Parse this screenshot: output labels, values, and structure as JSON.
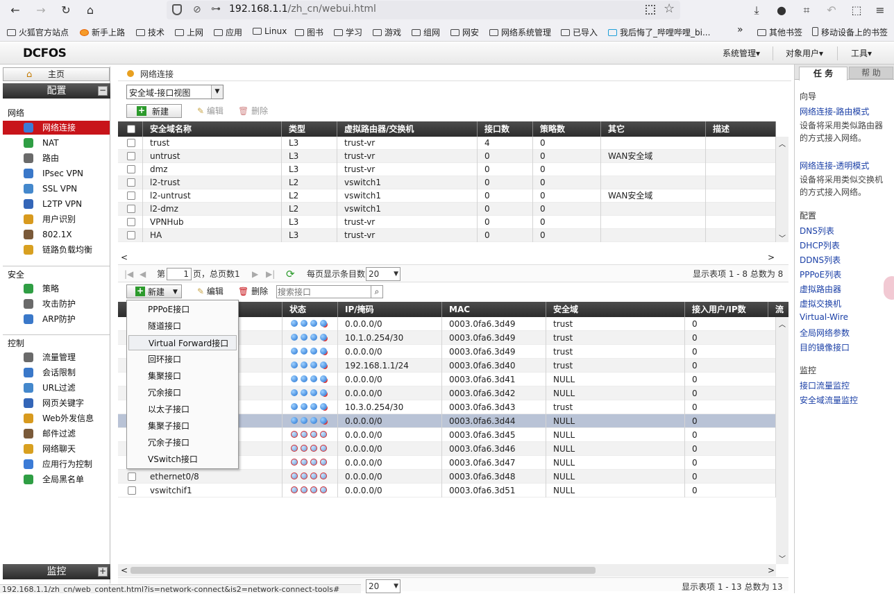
{
  "browser": {
    "url_host": "192.168.1.1",
    "url_path": "/zh_cn/webui.html",
    "bookmarks": [
      "火狐官方站点",
      "新手上路",
      "技术",
      "上网",
      "应用",
      "Linux",
      "图书",
      "学习",
      "游戏",
      "组网",
      "网安",
      "网络系统管理",
      "已导入",
      "我后悔了_哔哩哔哩_bi...",
      "其他书签",
      "移动设备上的书签"
    ],
    "status_url": "192.168.1.1/zh_cn/web_content.html?is=network-connect&is2=network-connect-tools#"
  },
  "app": {
    "logo": "DCFOS",
    "menus": [
      "系统管理▾",
      "对象用户▾",
      "工具▾"
    ]
  },
  "left": {
    "home": "主页",
    "config_bar": "配置",
    "config_toggle": "−",
    "sections": [
      {
        "title": "网络",
        "items": [
          "网络连接",
          "NAT",
          "路由",
          "IPsec VPN",
          "SSL VPN",
          "L2TP VPN",
          "用户识别",
          "802.1X",
          "链路负载均衡"
        ]
      },
      {
        "title": "安全",
        "items": [
          "策略",
          "攻击防护",
          "ARP防护"
        ]
      },
      {
        "title": "控制",
        "items": [
          "流量管理",
          "会话限制",
          "URL过滤",
          "网页关键字",
          "Web外发信息",
          "邮件过滤",
          "网络聊天",
          "应用行为控制",
          "全局黑名单"
        ]
      }
    ],
    "monitor_bar": "监控",
    "monitor_toggle": "+"
  },
  "main": {
    "breadcrumb": "网络连接",
    "view_select": "安全域-接口视图",
    "zone_toolbar": {
      "new": "新建",
      "edit": "编辑",
      "delete": "删除"
    },
    "zone_columns": [
      "安全域名称",
      "类型",
      "虚拟路由器/交换机",
      "接口数",
      "策略数",
      "其它",
      "描述"
    ],
    "zones": [
      [
        "trust",
        "L3",
        "trust-vr",
        "4",
        "0",
        ""
      ],
      [
        "untrust",
        "L3",
        "trust-vr",
        "0",
        "0",
        "WAN安全域"
      ],
      [
        "dmz",
        "L3",
        "trust-vr",
        "0",
        "0",
        ""
      ],
      [
        "l2-trust",
        "L2",
        "vswitch1",
        "0",
        "0",
        ""
      ],
      [
        "l2-untrust",
        "L2",
        "vswitch1",
        "0",
        "0",
        "WAN安全域"
      ],
      [
        "l2-dmz",
        "L2",
        "vswitch1",
        "0",
        "0",
        ""
      ],
      [
        "VPNHub",
        "L3",
        "trust-vr",
        "0",
        "0",
        ""
      ],
      [
        "HA",
        "L3",
        "trust-vr",
        "0",
        "0",
        ""
      ]
    ],
    "zone_pager": {
      "page_prefix": "第",
      "page": "1",
      "page_suffix": "页，总页数1",
      "per_page_label": "每页显示条目数",
      "per_page": "20",
      "summary": "显示表项 1 - 8 总数为 8"
    },
    "if_toolbar": {
      "new": "新建",
      "edit": "编辑",
      "delete": "删除",
      "search_placeholder": "搜索接口"
    },
    "if_columns": [
      "状态",
      "IP/掩码",
      "MAC",
      "安全域",
      "接入用户/IP数",
      "流"
    ],
    "interfaces": [
      {
        "name": "",
        "status": "up",
        "ip": "0.0.0.0/0",
        "mac": "0003.0fa6.3d49",
        "zone": "trust",
        "users": "0"
      },
      {
        "name": "",
        "status": "up",
        "ip": "10.1.0.254/30",
        "mac": "0003.0fa6.3d49",
        "zone": "trust",
        "users": "0"
      },
      {
        "name": "",
        "status": "up",
        "ip": "0.0.0.0/0",
        "mac": "0003.0fa6.3d49",
        "zone": "trust",
        "users": "0"
      },
      {
        "name": "",
        "status": "up",
        "ip": "192.168.1.1/24",
        "mac": "0003.0fa6.3d40",
        "zone": "trust",
        "users": "0"
      },
      {
        "name": "",
        "status": "up",
        "ip": "0.0.0.0/0",
        "mac": "0003.0fa6.3d41",
        "zone": "NULL",
        "users": "0"
      },
      {
        "name": "",
        "status": "up",
        "ip": "0.0.0.0/0",
        "mac": "0003.0fa6.3d42",
        "zone": "NULL",
        "users": "0"
      },
      {
        "name": "",
        "status": "up",
        "ip": "10.3.0.254/30",
        "mac": "0003.0fa6.3d43",
        "zone": "trust",
        "users": "0"
      },
      {
        "name": "",
        "status": "up",
        "ip": "0.0.0.0/0",
        "mac": "0003.0fa6.3d44",
        "zone": "NULL",
        "users": "0"
      },
      {
        "name": "",
        "status": "down",
        "ip": "0.0.0.0/0",
        "mac": "0003.0fa6.3d45",
        "zone": "NULL",
        "users": "0"
      },
      {
        "name": "",
        "status": "down",
        "ip": "0.0.0.0/0",
        "mac": "0003.0fa6.3d46",
        "zone": "NULL",
        "users": "0"
      },
      {
        "name": "",
        "status": "down",
        "ip": "0.0.0.0/0",
        "mac": "0003.0fa6.3d47",
        "zone": "NULL",
        "users": "0"
      },
      {
        "name": "ethernet0/8",
        "status": "down",
        "ip": "0.0.0.0/0",
        "mac": "0003.0fa6.3d48",
        "zone": "NULL",
        "users": "0"
      },
      {
        "name": "vswitchif1",
        "status": "down",
        "ip": "0.0.0.0/0",
        "mac": "0003.0fa6.3d51",
        "zone": "NULL",
        "users": "0"
      }
    ],
    "new_menu": [
      "PPPoE接口",
      "隧道接口",
      "Virtual Forward接口",
      "回环接口",
      "集聚接口",
      "冗余接口",
      "以太子接口",
      "集聚子接口",
      "冗余子接口",
      "VSwitch接口"
    ],
    "if_pager": {
      "per_page": "20",
      "summary": "显示表项 1 - 13 总数为 13"
    }
  },
  "right": {
    "tab_task": "任 务",
    "tab_help": "帮 助",
    "guide_title": "向导",
    "guides": [
      {
        "link": "网络连接-路由模式",
        "desc": "设备将采用类似路由器的方式接入网络。"
      },
      {
        "link": "网络连接-透明模式",
        "desc": "设备将采用类似交换机的方式接入网络。"
      }
    ],
    "config_title": "配置",
    "config_links": [
      "DNS列表",
      "DHCP列表",
      "DDNS列表",
      "PPPoE列表",
      "虚拟路由器",
      "虚拟交换机",
      "Virtual-Wire",
      "全局网络参数",
      "目的镜像接口"
    ],
    "monitor_title": "监控",
    "monitor_links": [
      "接口流量监控",
      "安全域流量监控"
    ]
  }
}
